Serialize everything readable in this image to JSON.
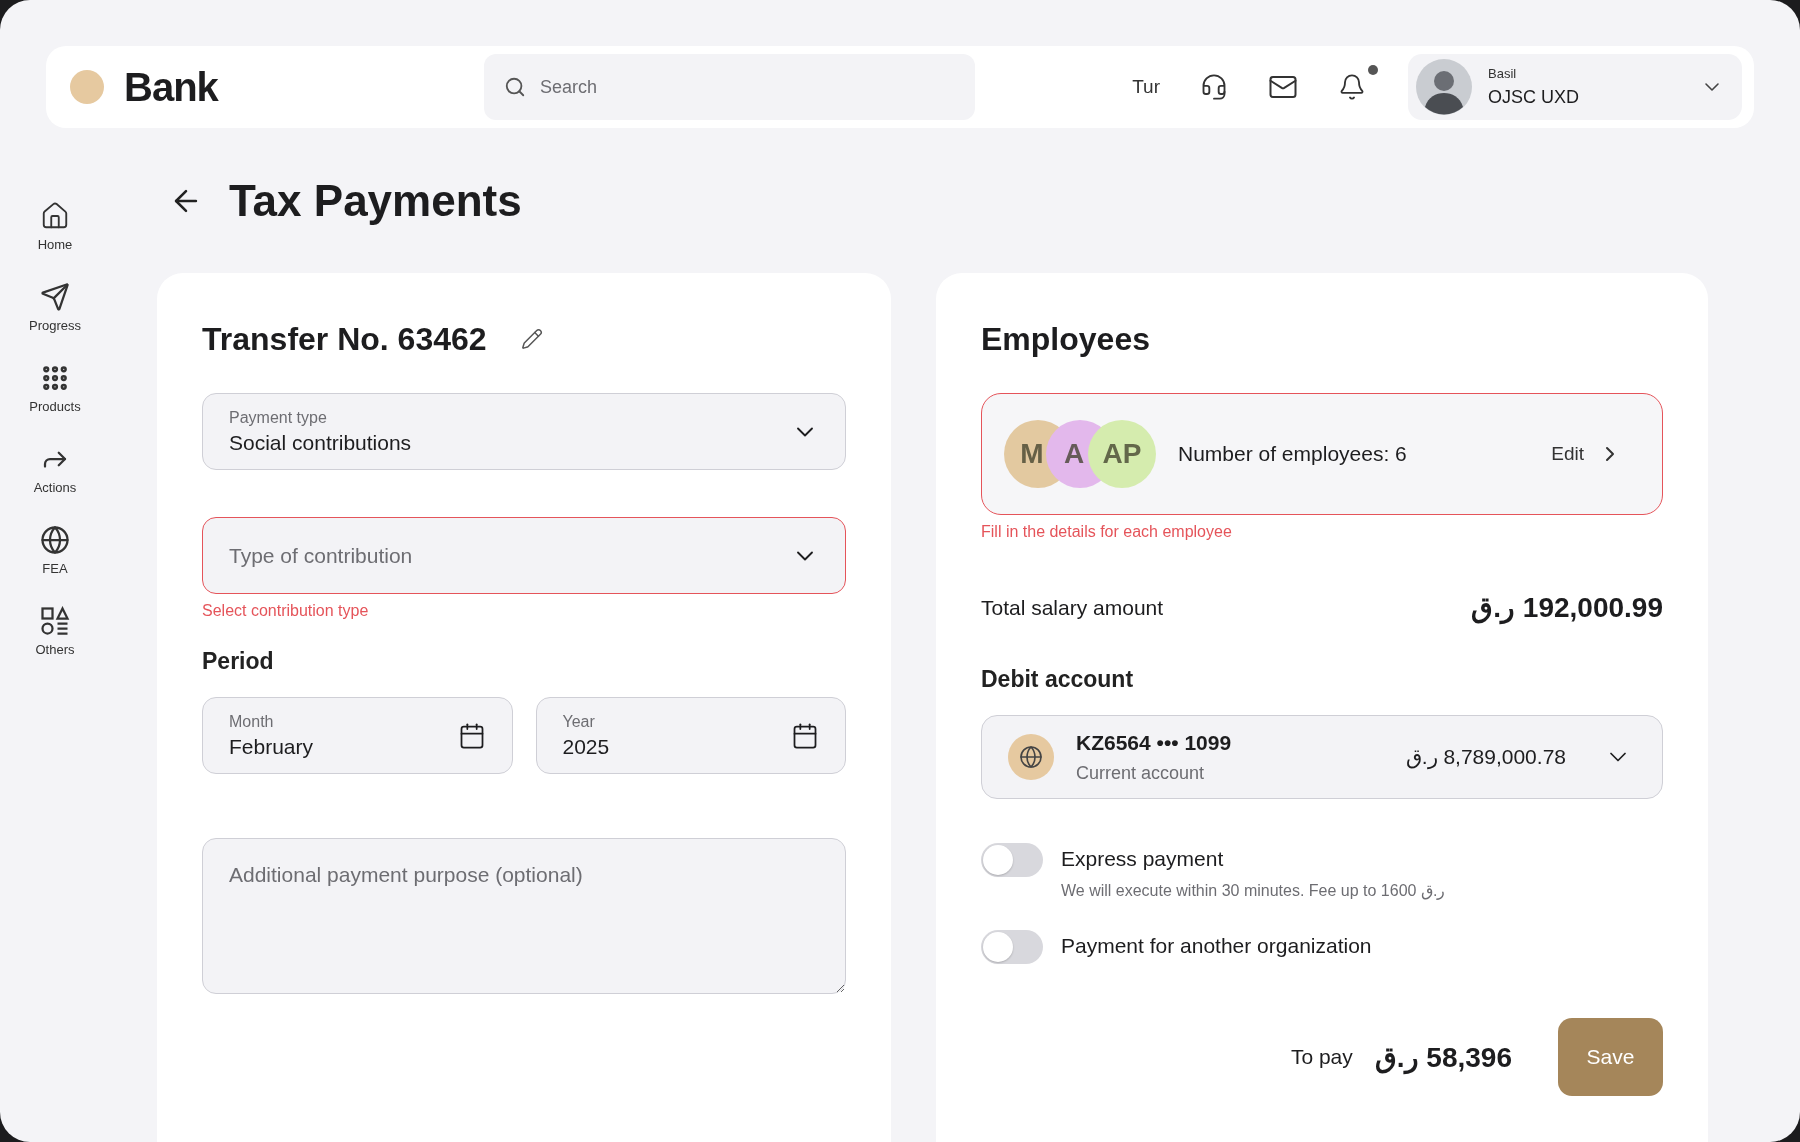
{
  "header": {
    "logo": "Bank",
    "search": {
      "placeholder": "Search"
    },
    "language": "Tur",
    "notification_dot": true,
    "profile": {
      "name": "Basil",
      "company": "OJSC UXD"
    }
  },
  "sidebar": {
    "items": [
      {
        "label": "Home"
      },
      {
        "label": "Progress"
      },
      {
        "label": "Products"
      },
      {
        "label": "Actions"
      },
      {
        "label": "FEA"
      },
      {
        "label": "Others"
      }
    ]
  },
  "page": {
    "title": "Tax Payments"
  },
  "transfer": {
    "title": "Transfer No. 63462",
    "payment_type": {
      "label": "Payment type",
      "value": "Social contributions",
      "error": false
    },
    "contribution": {
      "placeholder": "Type of contribution",
      "error": true,
      "error_text": "Select contribution type"
    },
    "period": {
      "title": "Period",
      "month": {
        "label": "Month",
        "value": "February"
      },
      "year": {
        "label": "Year",
        "value": "2025"
      }
    },
    "purpose": {
      "placeholder": "Additional payment purpose (optional)"
    }
  },
  "employees": {
    "title": "Employees",
    "error": true,
    "avatars": [
      {
        "initials": "M",
        "color": "#e3c9a0"
      },
      {
        "initials": "A",
        "color": "#e3b8ec"
      },
      {
        "initials": "AP",
        "color": "#d5ecae"
      }
    ],
    "count": "Number of employees: 6",
    "edit": "Edit",
    "error_text": "Fill in the details for each employee",
    "total_label": "Total salary amount",
    "total": "192,000.99 ر.ق",
    "debit_title": "Debit account",
    "account": {
      "number": "KZ6564 ••• 1099",
      "type": "Current account",
      "balance": "8,789,000.78 ر.ق"
    },
    "toggles": [
      {
        "label": "Express payment",
        "hint": "We will execute within 30 minutes. Fee up to 1600 ر.ق",
        "on": false
      },
      {
        "label": "Payment for another organization",
        "on": false
      }
    ],
    "to_pay_label": "To pay",
    "to_pay": "58,396 ر.ق",
    "save": "Save"
  }
}
